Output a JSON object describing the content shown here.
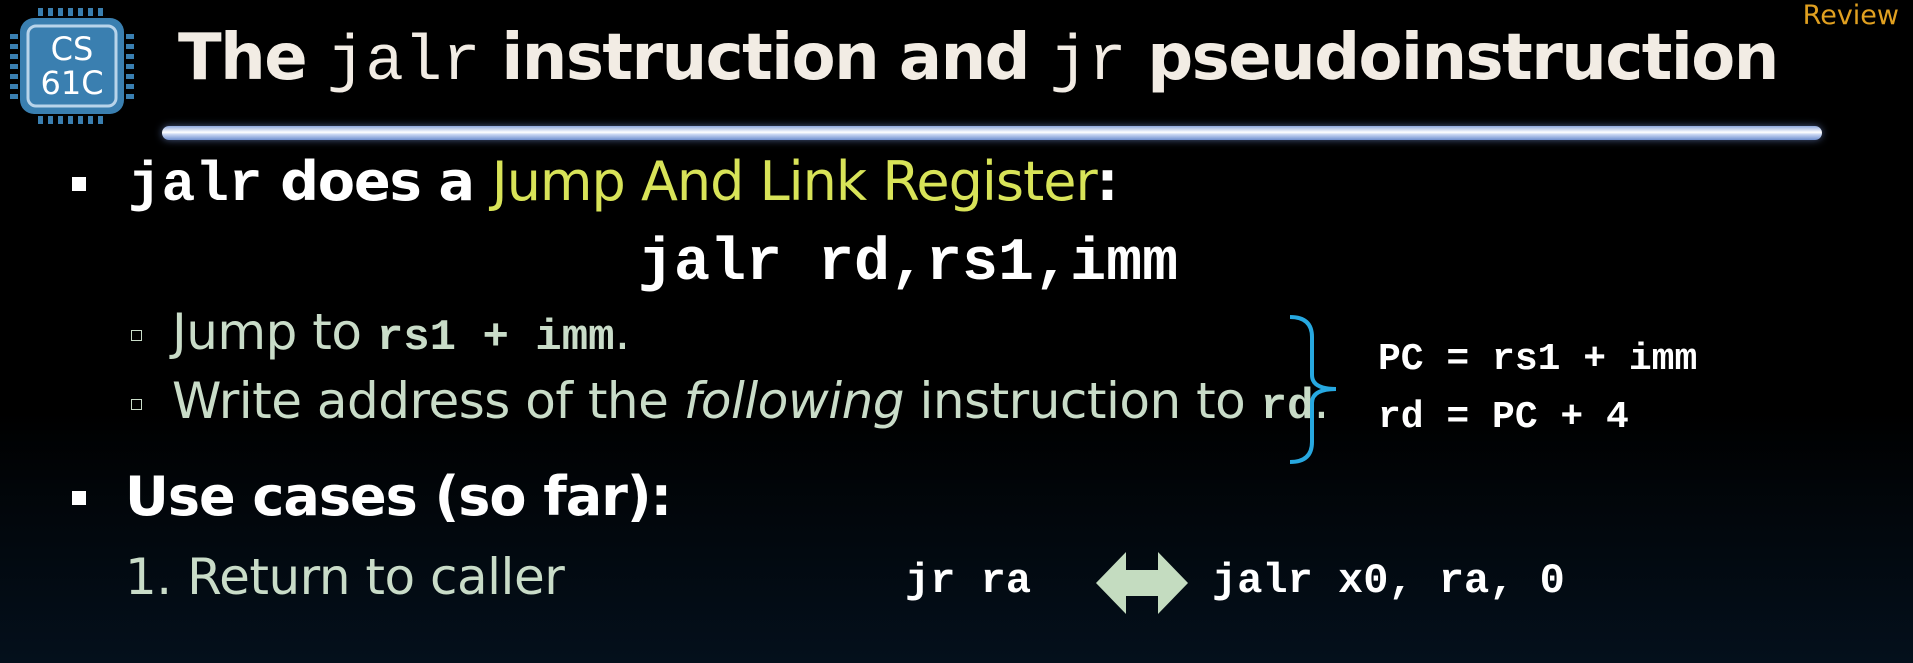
{
  "logo": {
    "line1": "CS",
    "line2": "61C",
    "icon": "chip-icon"
  },
  "header": {
    "title_pre": "The ",
    "title_code1": "jalr",
    "title_mid": " instruction and ",
    "title_code2": "jr",
    "title_post": " pseudoinstruction",
    "review": "Review"
  },
  "bullets": [
    {
      "code": "jalr",
      "text": " does a ",
      "highlight": "Jump And Link Register",
      "tail": ":"
    },
    {
      "text": "Use cases (so far):"
    }
  ],
  "syntax": "jalr rd,rs1,imm",
  "subbullets": [
    {
      "pre": "Jump to ",
      "code": "rs1 + imm",
      "post": "."
    },
    {
      "pre": "Write address of the ",
      "italic": "following",
      "mid": " instruction to ",
      "code": "rd",
      "post": "."
    }
  ],
  "equations": [
    "PC = rs1 + imm",
    "rd = PC + 4"
  ],
  "use_cases": [
    {
      "number": "1.",
      "label": "Return to caller",
      "pseudo": "jr ra",
      "real": "jalr x0, ra, 0"
    }
  ],
  "colors": {
    "highlight": "#d8e358",
    "sub_text": "#c9dcc8",
    "review": "#e0a020",
    "brace": "#27a8e0",
    "arrow": "#c4dcc0",
    "logo": "#3a7fb0"
  }
}
